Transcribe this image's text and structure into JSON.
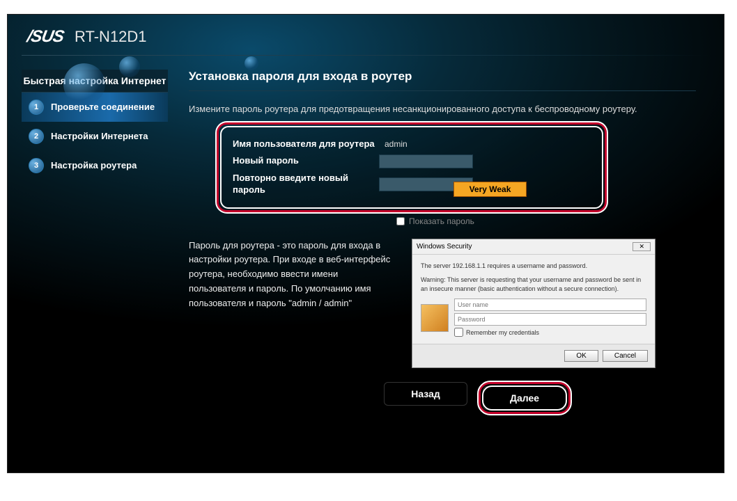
{
  "header": {
    "logo": "/SUS",
    "model": "RT-N12D1"
  },
  "sidebar": {
    "title": "Быстрая настройка Интернет",
    "steps": [
      {
        "num": "1",
        "label": "Проверьте соединение"
      },
      {
        "num": "2",
        "label": "Настройки Интернета"
      },
      {
        "num": "3",
        "label": "Настройка роутера"
      }
    ]
  },
  "main": {
    "title": "Установка пароля для входа в роутер",
    "desc": "Измените пароль роутера для предотвращения несанкционированного доступа к беспроводному роутеру.",
    "form": {
      "username_label": "Имя пользователя для роутера",
      "username_value": "admin",
      "newpw_label": "Новый пароль",
      "confirmpw_label": "Повторно введите новый пароль"
    },
    "strength": "Very Weak",
    "show_password": "Показать пароль",
    "help": "Пароль для роутера - это пароль для входа в настройки роутера. При входе в веб-интерфейс роутера, необходимо ввести имени пользователя и пароль. По умолчанию имя пользователя и пароль \"admin / admin\""
  },
  "dialog": {
    "title": "Windows Security",
    "line1": "The server 192.168.1.1 requires a username and password.",
    "line2": "Warning: This server is requesting that your username and password be sent in an insecure manner (basic authentication without a secure connection).",
    "username_ph": "User name",
    "password_ph": "Password",
    "remember": "Remember my credentials",
    "ok": "OK",
    "cancel": "Cancel"
  },
  "nav": {
    "back": "Назад",
    "next": "Далее"
  }
}
